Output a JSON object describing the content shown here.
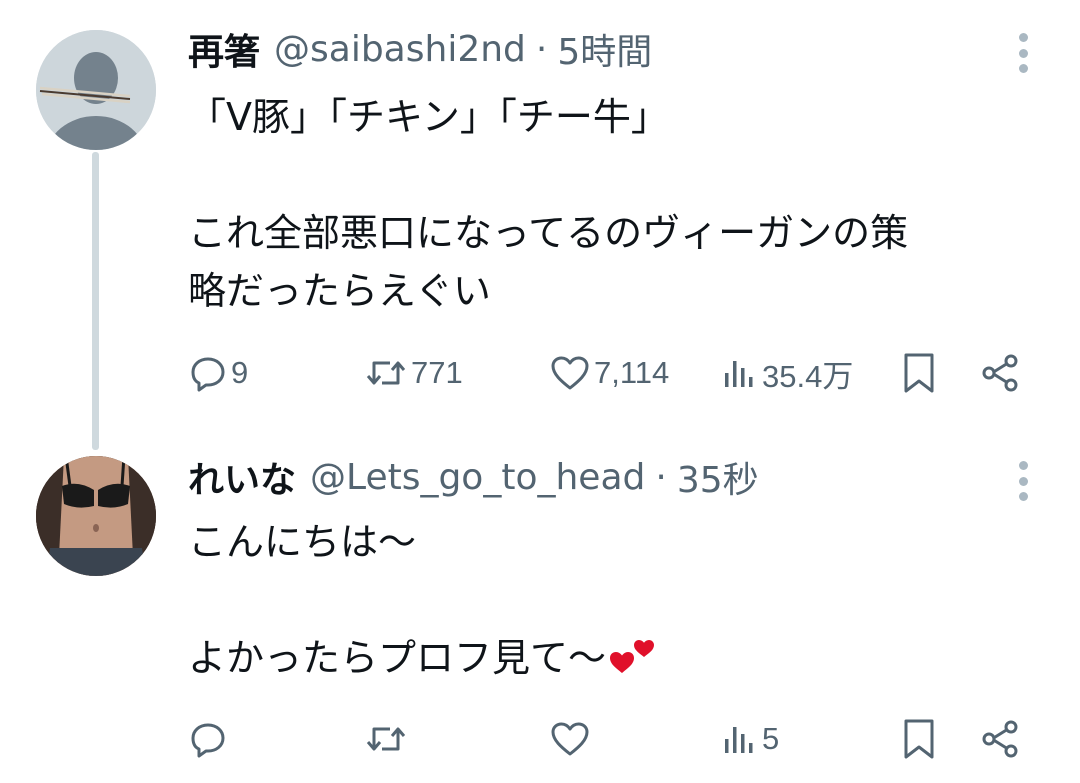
{
  "tweets": [
    {
      "display_name": "再箸",
      "handle": "@saibashi2nd",
      "separator": "·",
      "time": "5時間",
      "body": [
        "「V豚」「チキン」「チー牛」",
        "",
        "これ全部悪口になってるのヴィーガンの策",
        "略だったらえぐい"
      ],
      "stats": {
        "replies": "9",
        "retweets": "771",
        "likes": "7,114",
        "views": "35.4万"
      }
    },
    {
      "display_name": "れいな",
      "handle": "@Lets_go_to_head",
      "separator": "·",
      "time": "35秒",
      "body": [
        "こんにちは〜",
        "",
        "よかったらプロフ見て〜"
      ],
      "body_emoji": "two-hearts-emoji",
      "stats": {
        "replies": "",
        "retweets": "",
        "likes": "",
        "views": "5"
      }
    }
  ],
  "icons": {
    "reply": "reply-icon",
    "retweet": "retweet-icon",
    "like": "heart-icon",
    "views": "views-icon",
    "bookmark": "bookmark-icon",
    "share": "share-icon",
    "more": "more-options-icon"
  },
  "colors": {
    "text": "#0f1419",
    "secondary": "#536471",
    "thread_line": "#cfd9de",
    "emoji_heart": "#e0102a"
  }
}
